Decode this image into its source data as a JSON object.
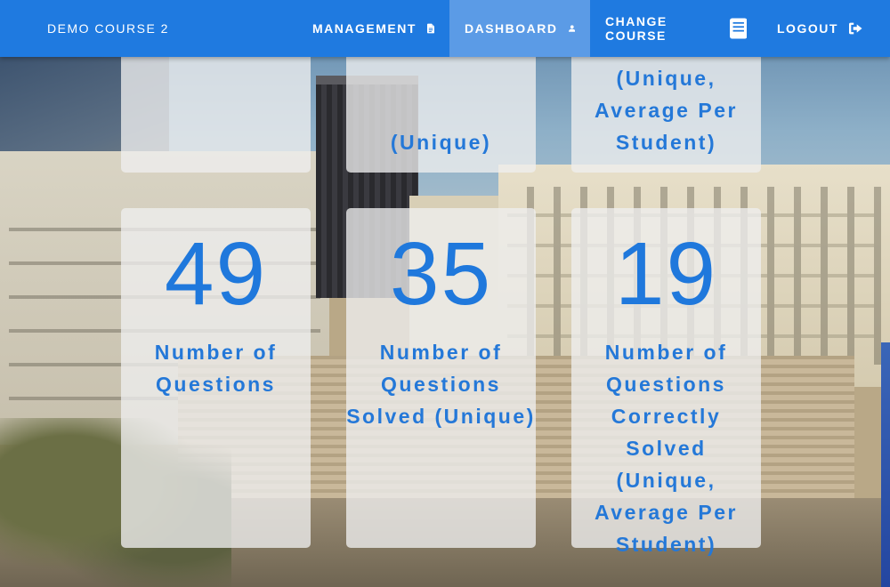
{
  "nav": {
    "course_title": "DEMO COURSE 2",
    "items": [
      {
        "label": "MANAGEMENT",
        "icon": "document-icon",
        "active": false
      },
      {
        "label": "DASHBOARD",
        "icon": "person-icon",
        "active": true
      },
      {
        "label": "CHANGE COURSE",
        "icon": "book-icon",
        "active": false
      },
      {
        "label": "LOGOUT",
        "icon": "logout-icon",
        "active": false
      }
    ]
  },
  "cards_top": [
    {
      "label_lines": []
    },
    {
      "label_lines": [
        "(Unique)"
      ]
    },
    {
      "label_lines": [
        "(Unique,",
        "Average Per",
        "Student)"
      ]
    }
  ],
  "cards_bottom": [
    {
      "value": "49",
      "label_lines": [
        "Number of",
        "Questions"
      ]
    },
    {
      "value": "35",
      "label_lines": [
        "Number of",
        "Questions",
        "Solved (Unique)"
      ]
    },
    {
      "value": "19",
      "label_lines": [
        "Number of",
        "Questions",
        "Correctly Solved",
        "(Unique,",
        "Average Per",
        "Student)"
      ]
    }
  ],
  "colors": {
    "nav_bg": "#1f7ae0",
    "nav_active_bg": "#5b9be6",
    "accent": "#1f78dc"
  }
}
